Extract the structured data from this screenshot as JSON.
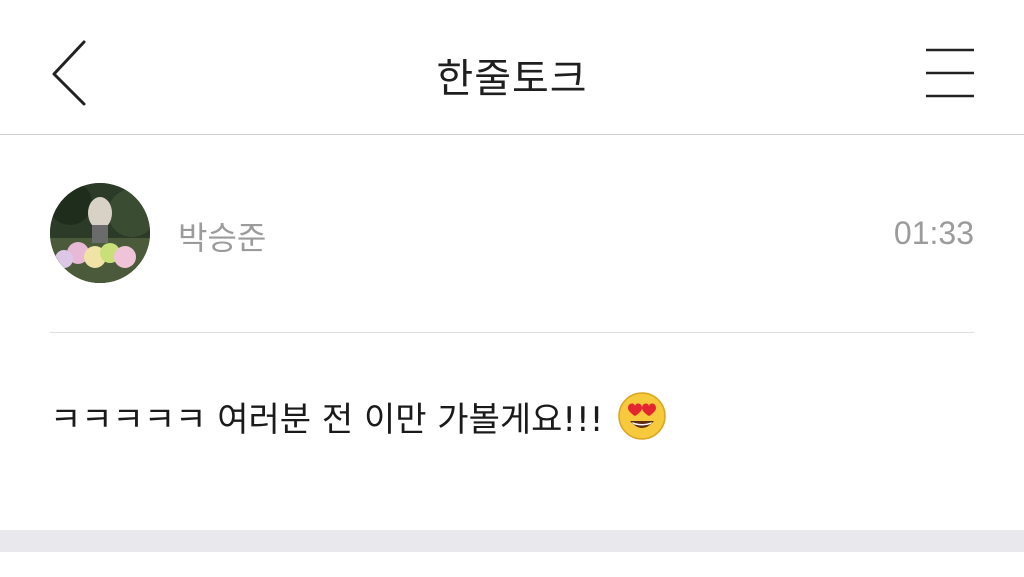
{
  "header": {
    "title": "한줄토크",
    "back_icon": "chevron-left-icon",
    "menu_icon": "hamburger-menu-icon"
  },
  "post": {
    "author": "박승준",
    "time": "01:33",
    "message": "ㅋㅋㅋㅋㅋ 여러분 전 이만 가볼게요!!!",
    "emoji": "heart-eyes-emoji-icon"
  },
  "colors": {
    "header_border": "#cfcfcf",
    "meta_text": "#9b9b9b",
    "footer_bar": "#e9e9ed"
  }
}
